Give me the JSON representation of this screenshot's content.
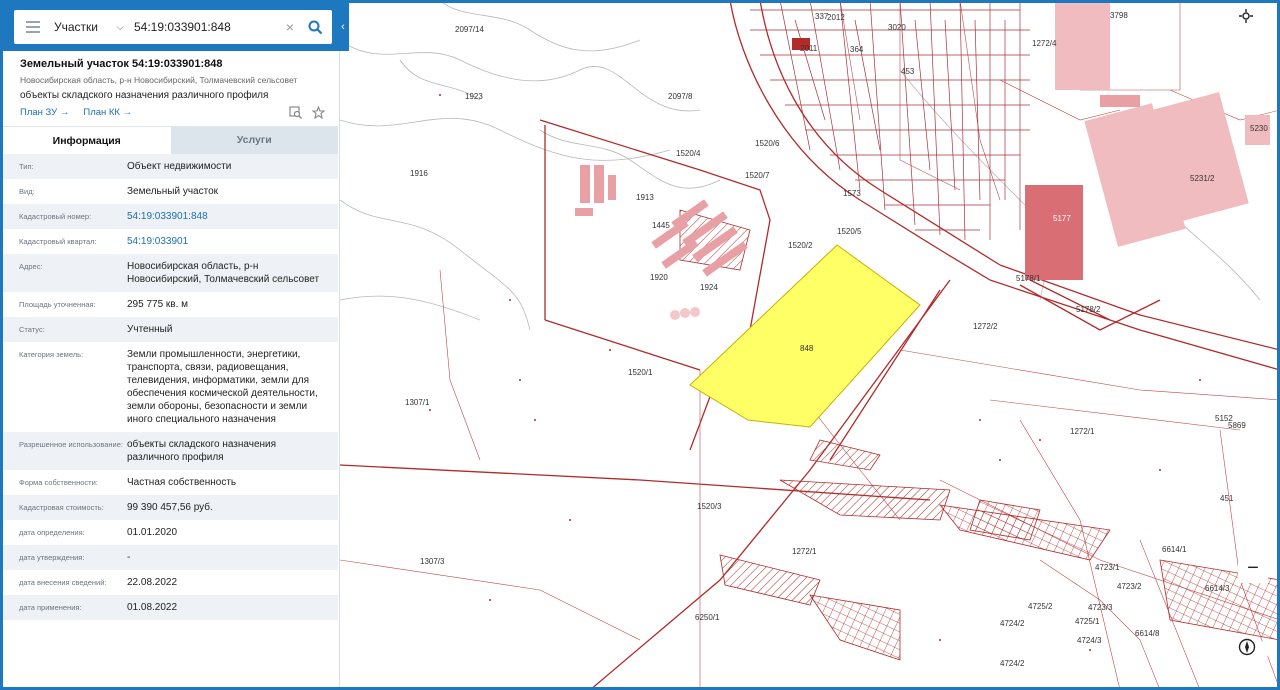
{
  "search": {
    "category": "Участки",
    "value": "54:19:033901:848"
  },
  "object": {
    "title": "Земельный участок 54:19:033901:848",
    "subtitle": "Новосибирская область, р-н Новосибирский, Толмачевский сельсовет",
    "description": "объекты складского назначения различного профиля",
    "link_zu": "План ЗУ →",
    "link_kk": "План КК →"
  },
  "tabs": {
    "info": "Информация",
    "services": "Услуги"
  },
  "rows": [
    {
      "k": "Тип:",
      "v": "Объект недвижимости"
    },
    {
      "k": "Вид:",
      "v": "Земельный участок"
    },
    {
      "k": "Кадастровый номер:",
      "v": "54:19:033901:848"
    },
    {
      "k": "Кадастровый квартал:",
      "v": "54:19:033901"
    },
    {
      "k": "Адрес:",
      "v": "Новосибирская область, р-н Новосибирский, Толмачевский сельсовет"
    },
    {
      "k": "Площадь уточненная:",
      "v": "295 775 кв. м"
    },
    {
      "k": "Статус:",
      "v": "Учтенный"
    },
    {
      "k": "Категория земель:",
      "v": "Земли промышленности, энергетики, транспорта, связи, радиовещания, телевидения, информатики, земли для обеспечения космической деятельности, земли обороны, безопасности и земли иного специального назначения"
    },
    {
      "k": "Разрешенное использование:",
      "v": "объекты складского назначения различного профиля"
    },
    {
      "k": "Форма собственности:",
      "v": "Частная собственность"
    },
    {
      "k": "Кадастровая стоимость:",
      "v": "99 390 457,56 руб."
    },
    {
      "k": "дата определения:",
      "v": "01.01.2020"
    },
    {
      "k": "дата утверждения:",
      "v": "-"
    },
    {
      "k": "дата внесения сведений:",
      "v": "22.08.2022"
    },
    {
      "k": "дата применения:",
      "v": "01.08.2022"
    }
  ],
  "map": {
    "labels": [
      "2097/14",
      "1923",
      "2097/8",
      "1520/4",
      "1520/6",
      "1520/7",
      "1913",
      "1445",
      "1520/2",
      "1520/5",
      "1920",
      "1924",
      "848",
      "1520/1",
      "1307/1",
      "1272/1",
      "1520/3",
      "1307/3",
      "1272/1",
      "6250/1",
      "5177",
      "5178/1",
      "5178/2",
      "1272/2",
      "3798",
      "5231/2",
      "5230",
      "2012",
      "2011",
      "337",
      "364",
      "453",
      "3020",
      "1272/4",
      "1573",
      "1916",
      "6614/1",
      "4723/1",
      "4723/2",
      "4725/2",
      "4723/3",
      "4724/2",
      "4725/1",
      "4724/3",
      "6614/8",
      "4724/2",
      "5152",
      "5869",
      "451",
      "6614/3"
    ],
    "highlight_color": "#ffff66",
    "boundary_color": "#b22a2a"
  },
  "controls": {
    "zoom_in": "+",
    "more": "•••",
    "zoom_out": "−"
  }
}
